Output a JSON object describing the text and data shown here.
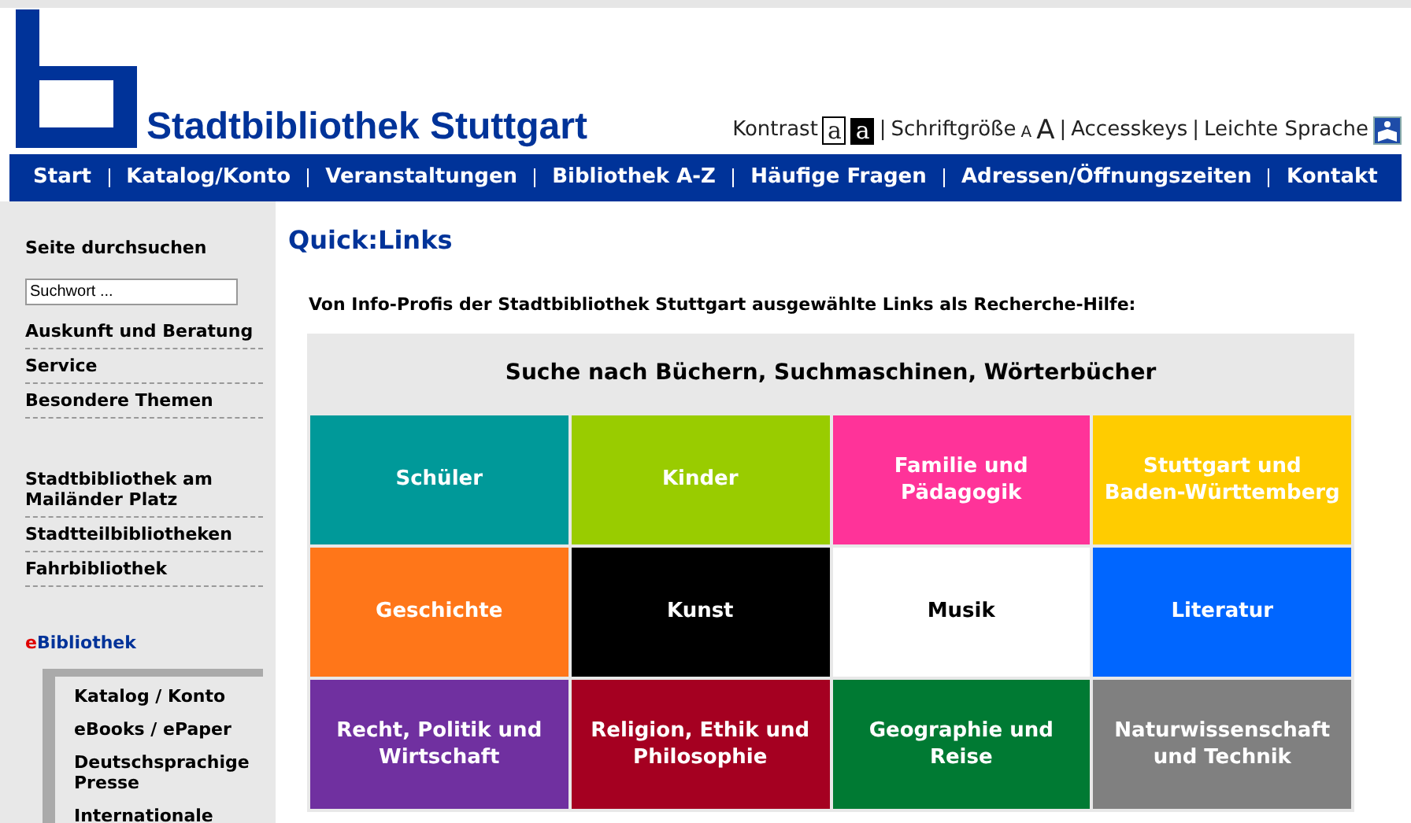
{
  "header": {
    "site_title": "Stadtbibliothek Stuttgart",
    "tools": [
      {
        "kind": "label",
        "text": "Kontrast"
      },
      {
        "kind": "contrast-normal",
        "text": "a"
      },
      {
        "kind": "contrast-inverse",
        "text": "a"
      },
      {
        "kind": "sep",
        "text": "|"
      },
      {
        "kind": "label",
        "text": "Schriftgröße"
      },
      {
        "kind": "size-small",
        "text": "A"
      },
      {
        "kind": "size-large",
        "text": "A"
      },
      {
        "kind": "sep",
        "text": "|"
      },
      {
        "kind": "link",
        "text": "Accesskeys"
      },
      {
        "kind": "sep",
        "text": "|"
      },
      {
        "kind": "link",
        "text": "Leichte Sprache"
      },
      {
        "kind": "icon"
      }
    ]
  },
  "nav": [
    "Start",
    "Katalog/Konto",
    "Veranstaltungen",
    "Bibliothek A-Z",
    "Häufige Fragen",
    "Adressen/Öffnungszeiten",
    "Kontakt"
  ],
  "sidebar": {
    "search_label": "Seite durchsuchen",
    "search_placeholder": "Suchwort ...",
    "groups": [
      [
        "Auskunft und Beratung",
        "Service",
        "Besondere Themen"
      ],
      [
        "Stadtbibliothek am Mailänder Platz",
        "Stadtteilbibliotheken",
        "Fahrbibliothek"
      ]
    ],
    "ebib": {
      "accent": "e",
      "rest": "Bibliothek"
    },
    "sub_items": [
      "Katalog / Konto",
      "eBooks / ePaper",
      "Deutschsprachige Presse",
      "Internationale"
    ]
  },
  "content": {
    "title": "Quick:Links",
    "intro": "Von Info-Profis der Stadtbibliothek Stuttgart ausgewählte Links als Recherche-Hilfe:",
    "section_title": "Suche nach Büchern, Suchmaschinen, Wörterbücher",
    "tiles": [
      {
        "label": "Schüler",
        "color": "#009999"
      },
      {
        "label": "Kinder",
        "color": "#99cc00"
      },
      {
        "label": "Familie und Pädagogik",
        "color": "#ff3399"
      },
      {
        "label": "Stuttgart und Baden-Württemberg",
        "color": "#ffcc00"
      },
      {
        "label": "Geschichte",
        "color": "#ff7619"
      },
      {
        "label": "Kunst",
        "color": "#000000"
      },
      {
        "label": "Musik",
        "color": "#ffffff"
      },
      {
        "label": "Literatur",
        "color": "#0066ff"
      },
      {
        "label": "Recht, Politik und Wirtschaft",
        "color": "#7030a0"
      },
      {
        "label": "Religion, Ethik und Philosophie",
        "color": "#a50021"
      },
      {
        "label": "Geographie und Reise",
        "color": "#007a33"
      },
      {
        "label": "Naturwissenschaft und Technik",
        "color": "#808080"
      }
    ]
  }
}
